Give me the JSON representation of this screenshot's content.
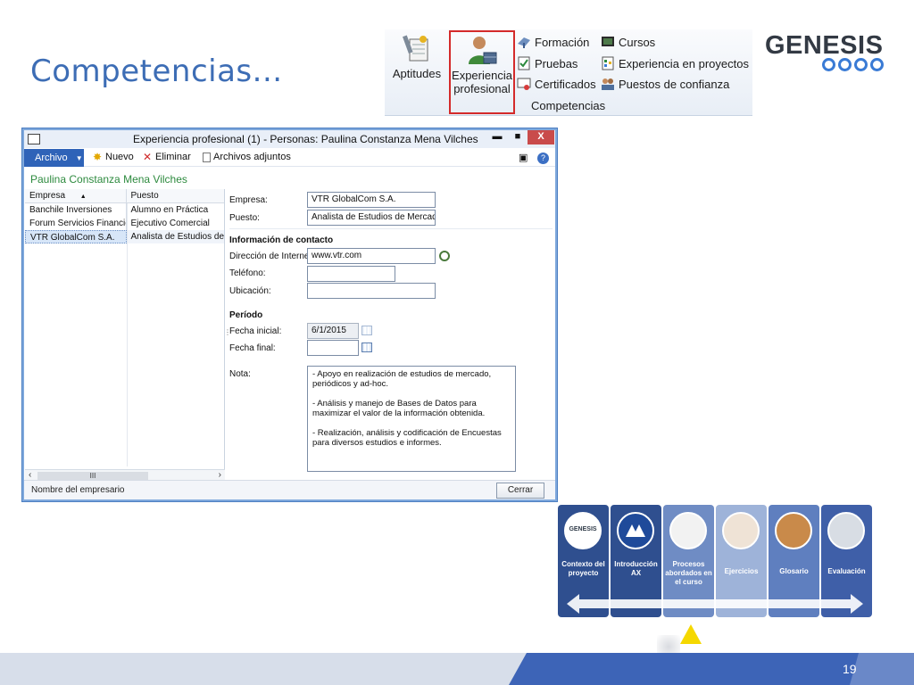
{
  "slide": {
    "title": "Competencias...",
    "page_number": "19"
  },
  "ribbon": {
    "aptitudes": "Aptitudes",
    "experiencia_line1": "Experiencia",
    "experiencia_line2": "profesional",
    "formacion": "Formación",
    "pruebas": "Pruebas",
    "certificados": "Certificados",
    "cursos": "Cursos",
    "experiencia_proyectos": "Experiencia en proyectos",
    "puestos_confianza": "Puestos de confianza",
    "group_label": "Competencias"
  },
  "logo": {
    "text": "GENESIS",
    "ring_color": "#3a7bd5"
  },
  "window": {
    "title": "Experiencia profesional (1) - Personas: Paulina Constanza Mena  Vilches",
    "btn_min": "▬",
    "btn_max": "■",
    "btn_close": "X",
    "toolbar": {
      "archivo": "Archivo",
      "nuevo": "Nuevo",
      "eliminar": "Eliminar",
      "adjuntos": "Archivos adjuntos"
    },
    "person_name": "Paulina Constanza Mena  Vilches",
    "grid": {
      "col_empresa": "Empresa",
      "col_puesto": "Puesto",
      "rows": [
        {
          "empresa": "Banchile Inversiones",
          "puesto": "Alumno en Práctica"
        },
        {
          "empresa": "Forum Servicios Financie...",
          "puesto": "Ejecutivo Comercial"
        },
        {
          "empresa": "VTR GlobalCom S.A.",
          "puesto": "Analista de Estudios de Me"
        }
      ],
      "scroll_thumb": "III"
    },
    "form": {
      "empresa_label": "Empresa:",
      "empresa_value": "VTR GlobalCom S.A.",
      "puesto_label": "Puesto:",
      "puesto_value": "Analista de Estudios de Mercad",
      "contacto_section": "Información de contacto",
      "internet_label": "Dirección de Internet:",
      "internet_value": "www.vtr.com",
      "telefono_label": "Teléfono:",
      "telefono_value": "",
      "ubicacion_label": "Ubicación:",
      "ubicacion_value": "",
      "periodo_section": "Período",
      "fecha_inicial_label": "Fecha inicial:",
      "fecha_inicial_value": "6/1/2015",
      "fecha_final_label": "Fecha final:",
      "fecha_final_value": "",
      "nota_label": "Nota:",
      "nota_p1": "- Apoyo en realización de estudios de mercado, periódicos y ad-hoc.",
      "nota_p2": "- Análisis y manejo de Bases de Datos para maximizar el valor de la información obtenida.",
      "nota_p3": "- Realización, análisis y codificación de Encuestas para diversos estudios e informes."
    },
    "status_text": "Nombre del empresario",
    "btn_cerrar": "Cerrar"
  },
  "nav": {
    "tiles": [
      {
        "label": "Contexto del proyecto",
        "badge": "GENESIS"
      },
      {
        "label": "Introducción AX"
      },
      {
        "label": "Procesos abordados en el curso"
      },
      {
        "label": "Ejercicios"
      },
      {
        "label": "Glosario"
      },
      {
        "label": "Evaluación"
      }
    ]
  },
  "colors": {
    "title_blue": "#3d6db5",
    "tile_dark": "#2f4f8f",
    "tile_light": "#9eb3d9",
    "footer_blue": "#3d64b7",
    "pointer_yellow": "#f5d800"
  }
}
